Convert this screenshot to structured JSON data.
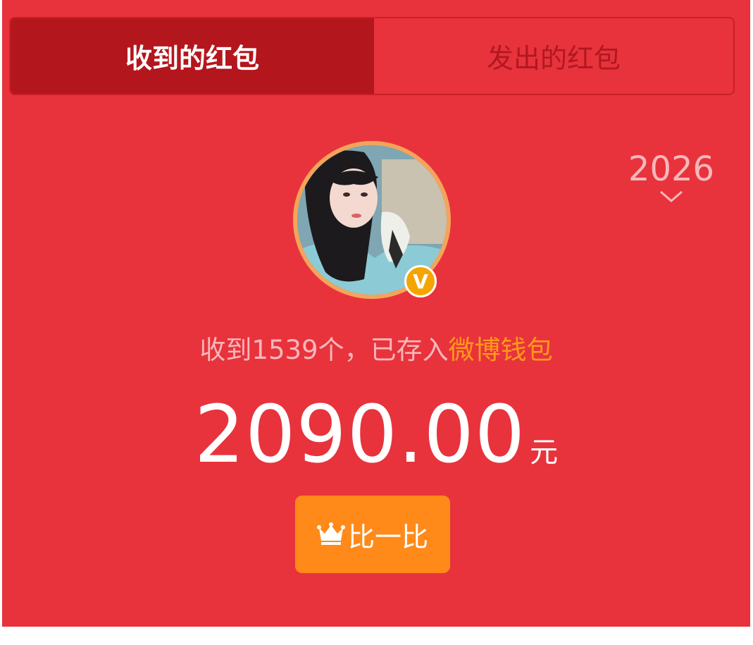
{
  "tabs": {
    "received": "收到的红包",
    "sent": "发出的红包"
  },
  "year": {
    "value": "2026",
    "icon": "chevron-down-icon"
  },
  "profile": {
    "badge": "V",
    "badge_color": "#f5a500"
  },
  "summary": {
    "prefix": "收到1539个，已存入",
    "wallet_link": "微博钱包"
  },
  "amount": {
    "value": "2090.00",
    "unit": "元"
  },
  "compare_button": {
    "label": "比一比",
    "icon": "crown-icon"
  },
  "colors": {
    "background": "#e8333c",
    "active_tab": "#b4161d",
    "accent": "#ff8a1a"
  }
}
